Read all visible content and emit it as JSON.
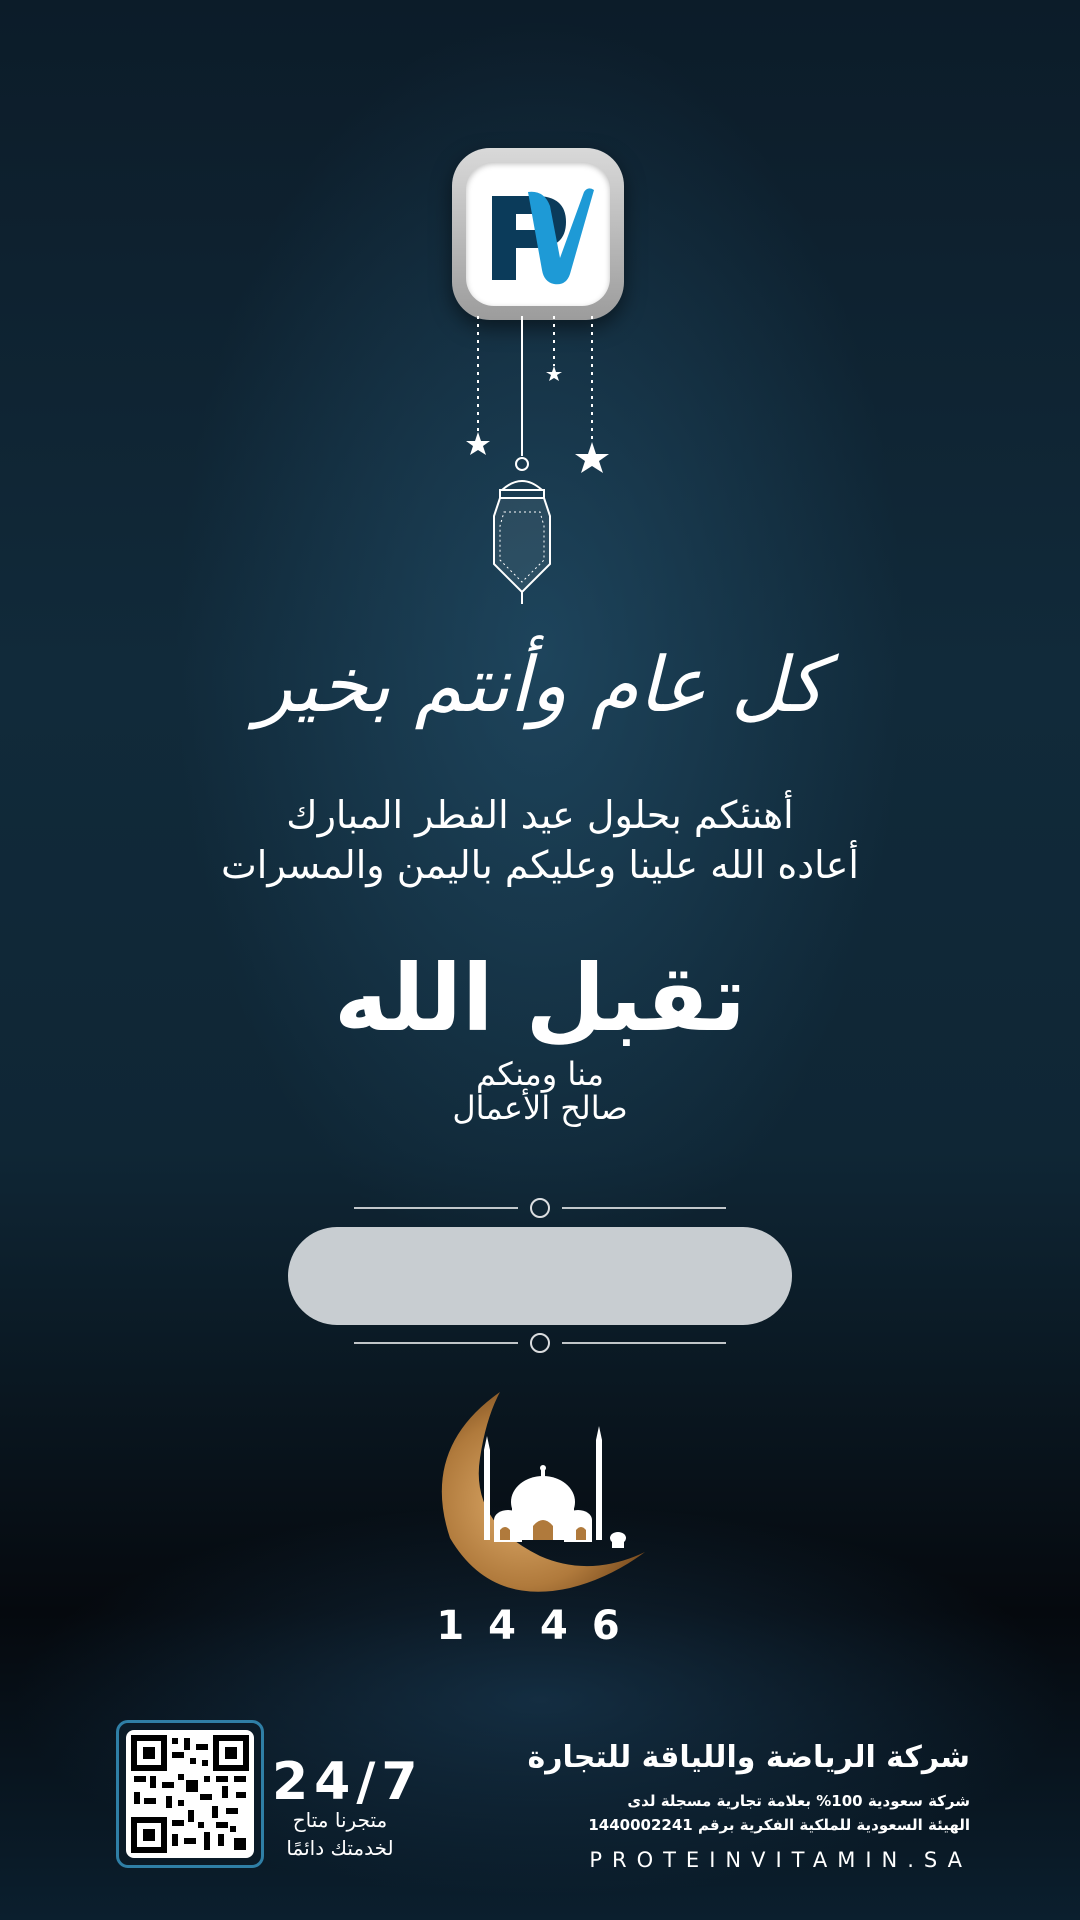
{
  "logo": {
    "text": "PV",
    "colors": {
      "dark": "#0b3b5a",
      "blue": "#1e9ad6"
    }
  },
  "greeting": {
    "title": "كل عام وأنتم بخير",
    "line1": "أهنئكم بحلول عيد الفطر المبارك",
    "line2": "أعاده الله علينا وعليكم باليمن والمسرات"
  },
  "blessing": {
    "main": "تقبل الله",
    "sub1": "منا ومنكم",
    "sub2": "صالح الأعمال"
  },
  "year": "1446",
  "footer": {
    "availability": "24/7",
    "store_line1": "متجرنا متاح",
    "store_line2": "لخدمتك دائمًا",
    "company_name": "شركة الرياضة واللياقة للتجارة",
    "company_line1": "شركة سعودية 100% بعلامة تجارية مسجلة لدى",
    "company_line2": "الهيئة السعودية للملكية الفكرية برقم 1440002241",
    "website": "PROTEINVITAMIN.SA"
  },
  "icons": [
    "star-icon",
    "lantern-icon",
    "crescent-moon-icon",
    "mosque-icon",
    "qr-code-icon"
  ],
  "colors": {
    "background": "#0f2635",
    "pill": "#c8cdd1",
    "gold": "#b07a3c",
    "qr_border": "#2f7fa6"
  }
}
